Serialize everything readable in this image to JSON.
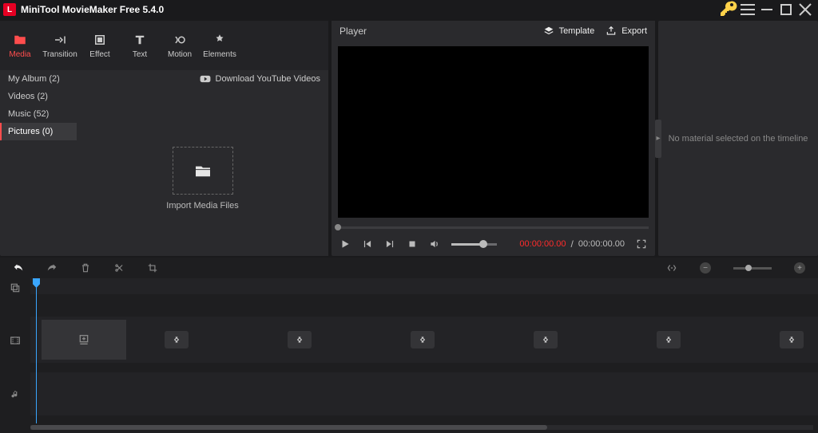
{
  "app": {
    "title": "MiniTool MovieMaker Free 5.4.0"
  },
  "tabs": {
    "media": "Media",
    "transition": "Transition",
    "effect": "Effect",
    "text": "Text",
    "motion": "Motion",
    "elements": "Elements"
  },
  "sidebar": {
    "my_album": "My Album (2)",
    "videos": "Videos (2)",
    "music": "Music (52)",
    "pictures": "Pictures (0)"
  },
  "media": {
    "download": "Download YouTube Videos",
    "import": "Import Media Files"
  },
  "player": {
    "label": "Player",
    "template": "Template",
    "export": "Export",
    "time_current": "00:00:00.00",
    "time_sep": " / ",
    "time_total": "00:00:00.00"
  },
  "props": {
    "empty": "No material selected on the timeline"
  }
}
